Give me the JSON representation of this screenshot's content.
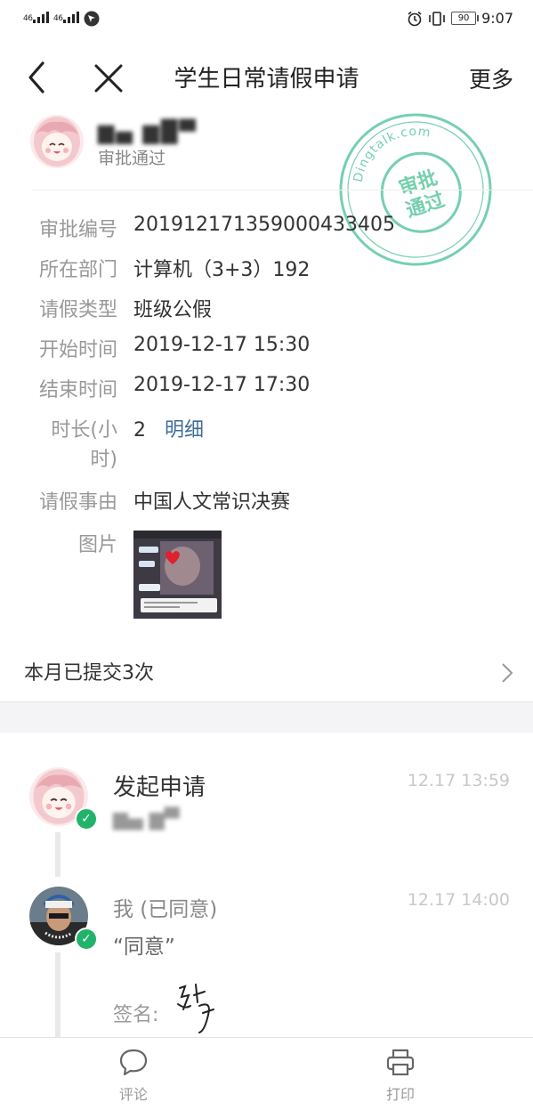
{
  "status_bar": {
    "signal_1": "46",
    "signal_2": "46",
    "battery": "90",
    "time": "9:07",
    "icons": [
      "signal-icon",
      "signal-icon",
      "app-icon",
      "alarm-icon",
      "vibrate-icon",
      "battery-icon"
    ]
  },
  "nav": {
    "title": "学生日常请假申请",
    "more_label": "更多",
    "back_icon": "chevron-left-icon",
    "close_icon": "close-icon"
  },
  "applicant": {
    "name_blurred": "▆▄ ▆█▀",
    "status": "审批通过"
  },
  "stamp": {
    "domain": "Dingtalk.com",
    "line1": "审批",
    "line2": "通过",
    "color": "#5ec8a0"
  },
  "fields": [
    {
      "label": "审批编号",
      "value": "201912171359000433405"
    },
    {
      "label": "所在部门",
      "value": "计算机（3+3）192"
    },
    {
      "label": "请假类型",
      "value": "班级公假"
    },
    {
      "label": "开始时间",
      "value": "2019-12-17 15:30"
    },
    {
      "label": "结束时间",
      "value": "2019-12-17 17:30"
    }
  ],
  "duration": {
    "label_line1": "时长(小",
    "label_line2": "时)",
    "value": "2",
    "detail_link": "明细"
  },
  "reason": {
    "label": "请假事由",
    "value": "中国人文常识决赛"
  },
  "images": {
    "label": "图片"
  },
  "monthly": {
    "text": "本月已提交3次"
  },
  "timeline": [
    {
      "title": "发起申请",
      "subtitle": "▆▄ ▆▀",
      "time": "12.17 13:59"
    },
    {
      "title": "我 (已同意)",
      "time": "12.17 14:00",
      "comment": "“同意”",
      "sign_label": "签名:"
    }
  ],
  "bottom_bar": {
    "comment_label": "评论",
    "print_label": "打印"
  },
  "colors": {
    "accent_green": "#22b36b",
    "link_blue": "#3f6d9b",
    "stamp_green": "#5ec8a0"
  }
}
